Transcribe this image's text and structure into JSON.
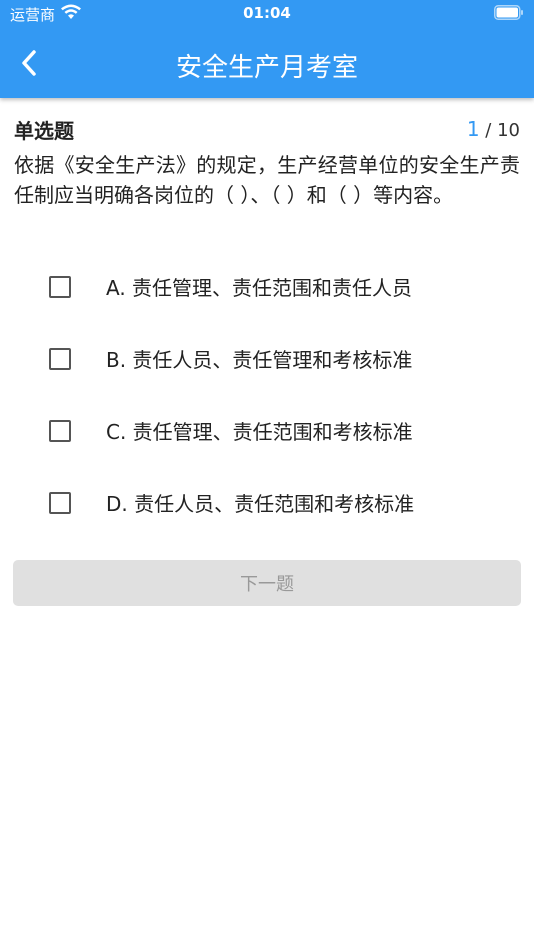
{
  "status_bar": {
    "carrier": "运营商",
    "time": "01:04",
    "wifi_icon": "wifi-icon",
    "battery_icon": "battery-icon"
  },
  "nav": {
    "title": "安全生产月考室",
    "back_icon": "chevron-left-icon"
  },
  "question": {
    "type_label": "单选题",
    "current": "1",
    "separator": " / ",
    "total": "10",
    "text": "依据《安全生产法》的规定，生产经营单位的安全生产责任制应当明确各岗位的（ ）、（ ）和（ ）等内容。",
    "options": [
      {
        "label": "A. 责任管理、责任范围和责任人员"
      },
      {
        "label": "B. 责任人员、责任管理和考核标准"
      },
      {
        "label": "C. 责任管理、责任范围和考核标准"
      },
      {
        "label": "D. 责任人员、责任范围和考核标准"
      }
    ]
  },
  "next_button": {
    "label": "下一题"
  },
  "colors": {
    "primary": "#3399f3",
    "button_disabled_bg": "#e0e0e0",
    "button_disabled_text": "#999999"
  }
}
